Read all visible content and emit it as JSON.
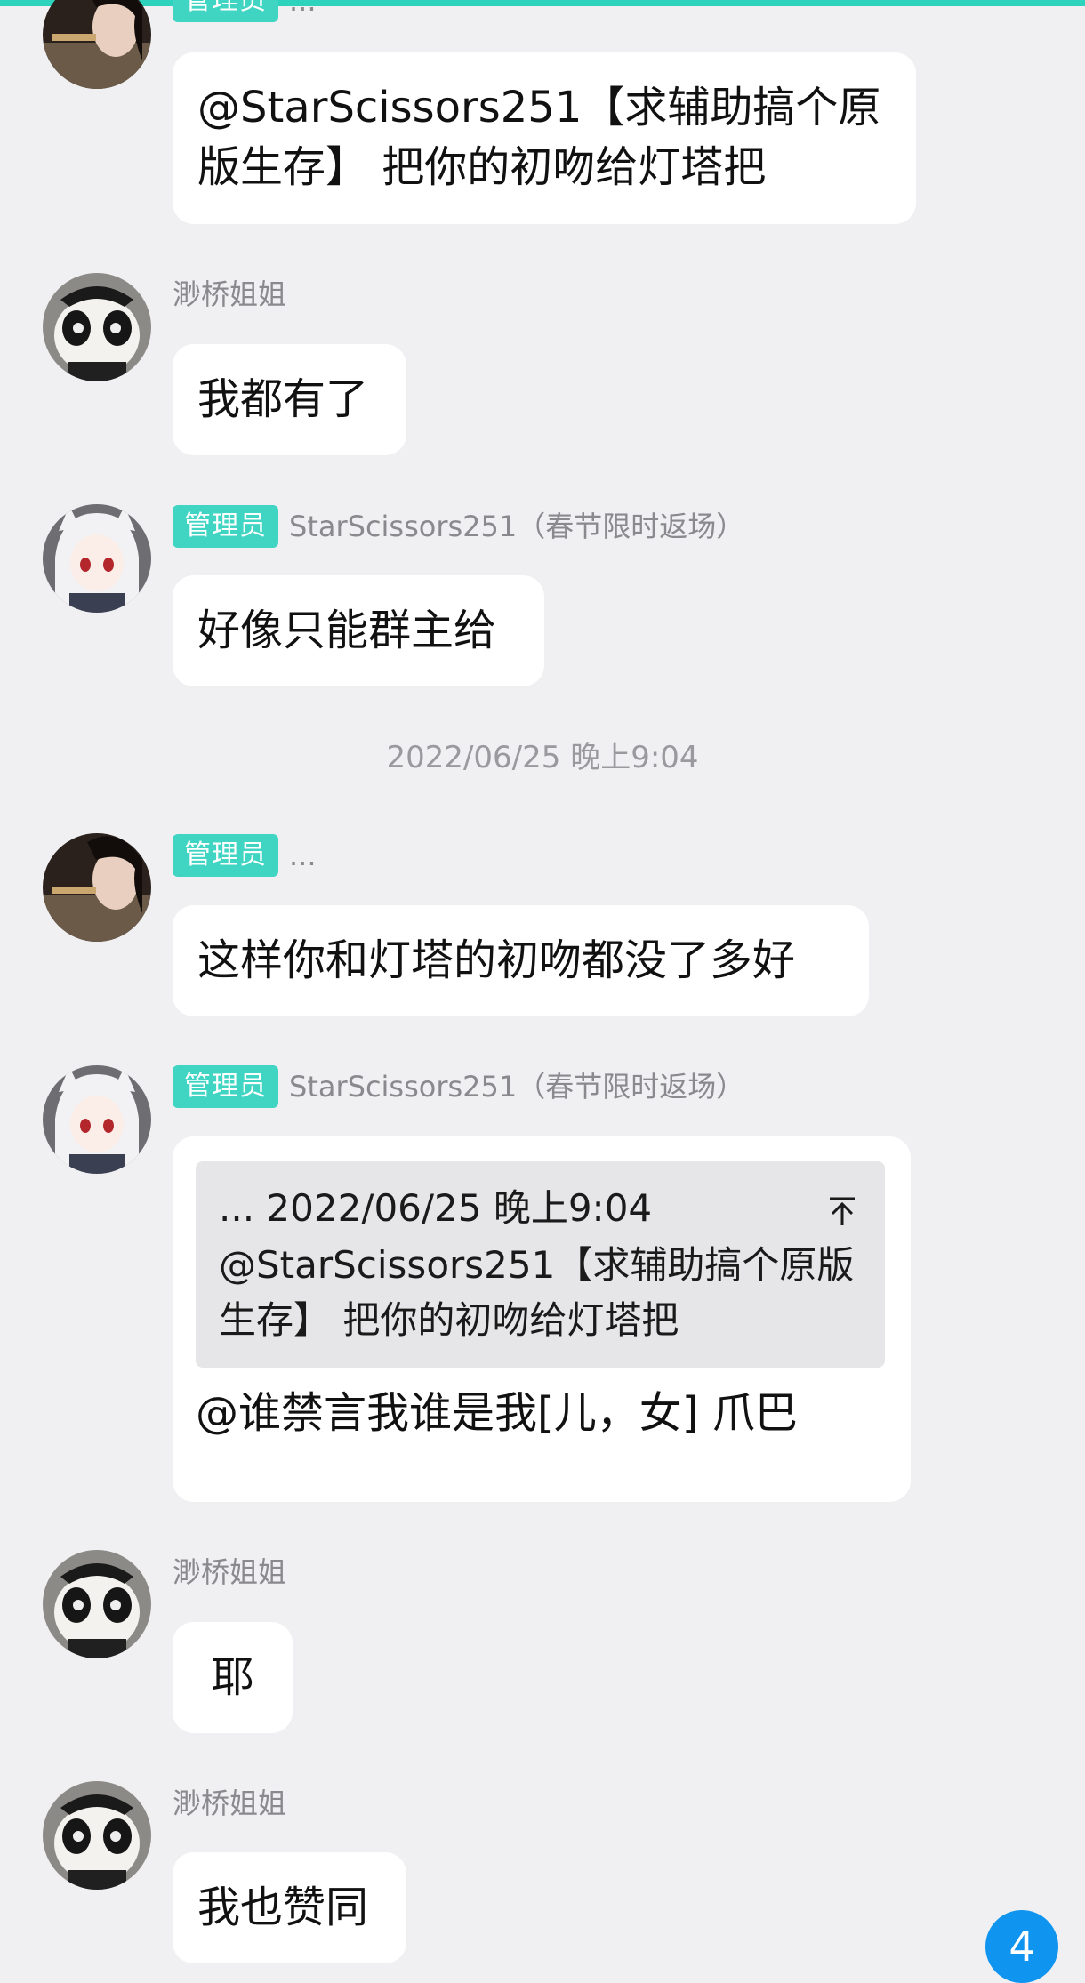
{
  "badge_label": "管理员",
  "messages": [
    {
      "sender": "...",
      "is_admin": true,
      "lines": [
        "@StarScissors251【求辅助搞个原",
        "版生存】 把你的初吻给灯塔把"
      ]
    },
    {
      "sender": "渺桥姐姐",
      "is_admin": false,
      "lines": [
        "我都有了"
      ]
    },
    {
      "sender": "StarScissors251（春节限时返场）",
      "is_admin": true,
      "lines": [
        "好像只能群主给"
      ]
    },
    {
      "timestamp": "2022/06/25 晚上9:04"
    },
    {
      "sender": "...",
      "is_admin": true,
      "lines": [
        "这样你和灯塔的初吻都没了多好"
      ]
    },
    {
      "sender": "StarScissors251（春节限时返场）",
      "is_admin": true,
      "quote": {
        "header": "... 2022/06/25 晚上9:04",
        "icon": "jump-to-original-icon",
        "lines": [
          "@StarScissors251【求辅助搞个原版",
          "生存】 把你的初吻给灯塔把"
        ]
      },
      "lines": [
        "@谁禁言我谁是我[儿，女] 爪巴"
      ]
    },
    {
      "sender": "渺桥姐姐",
      "is_admin": false,
      "lines": [
        "耶"
      ]
    },
    {
      "sender": "渺桥姐姐",
      "is_admin": false,
      "lines": [
        "我也赞同"
      ]
    }
  ],
  "unread_count": "4",
  "colors": {
    "accent": "#2ed3bd",
    "badge": "#40d5c3",
    "unread_badge": "#0f94ef",
    "background": "#f0f0f2"
  }
}
